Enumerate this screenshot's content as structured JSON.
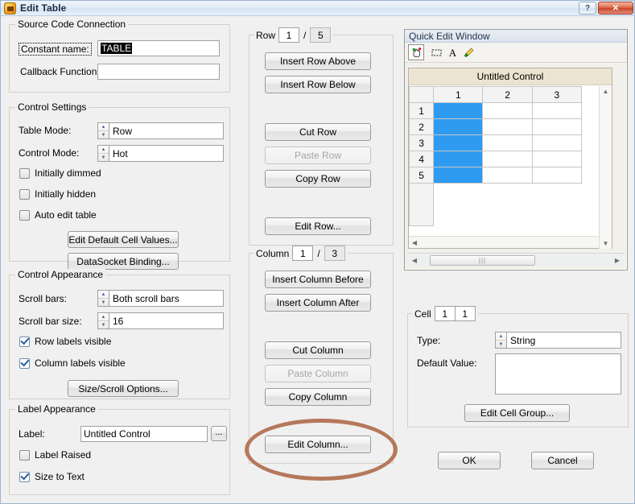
{
  "window": {
    "title": "Edit Table",
    "icon": "cvi-app-icon",
    "buttons": {
      "help": "?",
      "close": "✕"
    }
  },
  "source_code_connection": {
    "legend": "Source Code Connection",
    "constant_name_label": "Constant name:",
    "constant_name_value": "TABLE",
    "callback_label": "Callback Function:",
    "callback_value": ""
  },
  "control_settings": {
    "legend": "Control Settings",
    "table_mode_label": "Table Mode:",
    "table_mode_value": "Row",
    "control_mode_label": "Control Mode:",
    "control_mode_value": "Hot",
    "initially_dimmed": {
      "label": "Initially dimmed",
      "checked": false
    },
    "initially_hidden": {
      "label": "Initially hidden",
      "checked": false
    },
    "auto_edit_table": {
      "label": "Auto edit table",
      "checked": false
    },
    "edit_default_cell_values": "Edit Default Cell Values...",
    "datasocket_binding": "DataSocket Binding..."
  },
  "control_appearance": {
    "legend": "Control Appearance",
    "scroll_bars_label": "Scroll bars:",
    "scroll_bars_value": "Both scroll bars",
    "scroll_bar_size_label": "Scroll bar size:",
    "scroll_bar_size_value": "16",
    "row_labels_visible": {
      "label": "Row labels visible",
      "checked": true
    },
    "column_labels_visible": {
      "label": "Column labels visible",
      "checked": true
    },
    "size_scroll_options": "Size/Scroll Options..."
  },
  "label_appearance": {
    "legend": "Label Appearance",
    "label_label": "Label:",
    "label_value": "Untitled Control",
    "browse_button": "...",
    "label_raised": {
      "label": "Label Raised",
      "checked": false
    },
    "size_to_text": {
      "label": "Size to Text",
      "checked": true
    }
  },
  "row_group": {
    "legend": "Row",
    "current": "1",
    "separator": "/",
    "total": "5",
    "buttons": [
      {
        "label": "Insert Row Above",
        "disabled": false
      },
      {
        "label": "Insert Row Below",
        "disabled": false
      },
      {
        "label": "Cut Row",
        "disabled": false
      },
      {
        "label": "Paste Row",
        "disabled": true
      },
      {
        "label": "Copy Row",
        "disabled": false
      },
      {
        "label": "Edit Row...",
        "disabled": false
      }
    ]
  },
  "column_group": {
    "legend": "Column",
    "current": "1",
    "separator": "/",
    "total": "3",
    "buttons": [
      {
        "label": "Insert Column Before",
        "disabled": false
      },
      {
        "label": "Insert Column After",
        "disabled": false
      },
      {
        "label": "Cut Column",
        "disabled": false
      },
      {
        "label": "Paste Column",
        "disabled": true
      },
      {
        "label": "Copy Column",
        "disabled": false
      },
      {
        "label": "Edit Column...",
        "disabled": false
      }
    ]
  },
  "quick_edit_window": {
    "title": "Quick Edit Window",
    "toolbar": [
      {
        "icon": "hand-pointer-icon",
        "active": true
      },
      {
        "icon": "dashed-selection-icon",
        "active": false
      },
      {
        "icon": "text-a-icon",
        "active": false
      },
      {
        "icon": "paintbrush-icon",
        "active": false
      }
    ],
    "table_caption": "Untitled Control",
    "column_headers": [
      "1",
      "2",
      "3"
    ],
    "row_headers": [
      "1",
      "2",
      "3",
      "4",
      "5"
    ],
    "selected_column": 1,
    "selection_color": "#2e9bf0",
    "caption_bg": "#ece4d1"
  },
  "cell_group": {
    "legend": "Cell",
    "row": "1",
    "col": "1",
    "type_label": "Type:",
    "type_value": "String",
    "default_value_label": "Default Value:",
    "default_value": "",
    "edit_cell_group": "Edit Cell Group..."
  },
  "dialog_buttons": {
    "ok": "OK",
    "cancel": "Cancel"
  },
  "annotation": {
    "shape": "ellipse",
    "color": "#b5785a",
    "target": "Edit Column..."
  }
}
